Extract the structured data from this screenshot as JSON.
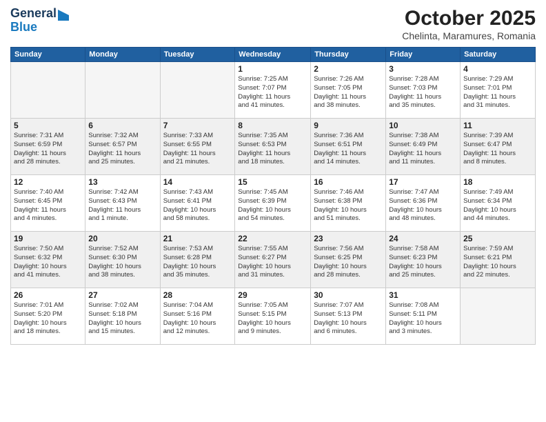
{
  "header": {
    "logo_general": "General",
    "logo_blue": "Blue",
    "month_title": "October 2025",
    "location": "Chelinta, Maramures, Romania"
  },
  "days_of_week": [
    "Sunday",
    "Monday",
    "Tuesday",
    "Wednesday",
    "Thursday",
    "Friday",
    "Saturday"
  ],
  "weeks": [
    [
      {
        "day": "",
        "info": ""
      },
      {
        "day": "",
        "info": ""
      },
      {
        "day": "",
        "info": ""
      },
      {
        "day": "1",
        "info": "Sunrise: 7:25 AM\nSunset: 7:07 PM\nDaylight: 11 hours\nand 41 minutes."
      },
      {
        "day": "2",
        "info": "Sunrise: 7:26 AM\nSunset: 7:05 PM\nDaylight: 11 hours\nand 38 minutes."
      },
      {
        "day": "3",
        "info": "Sunrise: 7:28 AM\nSunset: 7:03 PM\nDaylight: 11 hours\nand 35 minutes."
      },
      {
        "day": "4",
        "info": "Sunrise: 7:29 AM\nSunset: 7:01 PM\nDaylight: 11 hours\nand 31 minutes."
      }
    ],
    [
      {
        "day": "5",
        "info": "Sunrise: 7:31 AM\nSunset: 6:59 PM\nDaylight: 11 hours\nand 28 minutes."
      },
      {
        "day": "6",
        "info": "Sunrise: 7:32 AM\nSunset: 6:57 PM\nDaylight: 11 hours\nand 25 minutes."
      },
      {
        "day": "7",
        "info": "Sunrise: 7:33 AM\nSunset: 6:55 PM\nDaylight: 11 hours\nand 21 minutes."
      },
      {
        "day": "8",
        "info": "Sunrise: 7:35 AM\nSunset: 6:53 PM\nDaylight: 11 hours\nand 18 minutes."
      },
      {
        "day": "9",
        "info": "Sunrise: 7:36 AM\nSunset: 6:51 PM\nDaylight: 11 hours\nand 14 minutes."
      },
      {
        "day": "10",
        "info": "Sunrise: 7:38 AM\nSunset: 6:49 PM\nDaylight: 11 hours\nand 11 minutes."
      },
      {
        "day": "11",
        "info": "Sunrise: 7:39 AM\nSunset: 6:47 PM\nDaylight: 11 hours\nand 8 minutes."
      }
    ],
    [
      {
        "day": "12",
        "info": "Sunrise: 7:40 AM\nSunset: 6:45 PM\nDaylight: 11 hours\nand 4 minutes."
      },
      {
        "day": "13",
        "info": "Sunrise: 7:42 AM\nSunset: 6:43 PM\nDaylight: 11 hours\nand 1 minute."
      },
      {
        "day": "14",
        "info": "Sunrise: 7:43 AM\nSunset: 6:41 PM\nDaylight: 10 hours\nand 58 minutes."
      },
      {
        "day": "15",
        "info": "Sunrise: 7:45 AM\nSunset: 6:39 PM\nDaylight: 10 hours\nand 54 minutes."
      },
      {
        "day": "16",
        "info": "Sunrise: 7:46 AM\nSunset: 6:38 PM\nDaylight: 10 hours\nand 51 minutes."
      },
      {
        "day": "17",
        "info": "Sunrise: 7:47 AM\nSunset: 6:36 PM\nDaylight: 10 hours\nand 48 minutes."
      },
      {
        "day": "18",
        "info": "Sunrise: 7:49 AM\nSunset: 6:34 PM\nDaylight: 10 hours\nand 44 minutes."
      }
    ],
    [
      {
        "day": "19",
        "info": "Sunrise: 7:50 AM\nSunset: 6:32 PM\nDaylight: 10 hours\nand 41 minutes."
      },
      {
        "day": "20",
        "info": "Sunrise: 7:52 AM\nSunset: 6:30 PM\nDaylight: 10 hours\nand 38 minutes."
      },
      {
        "day": "21",
        "info": "Sunrise: 7:53 AM\nSunset: 6:28 PM\nDaylight: 10 hours\nand 35 minutes."
      },
      {
        "day": "22",
        "info": "Sunrise: 7:55 AM\nSunset: 6:27 PM\nDaylight: 10 hours\nand 31 minutes."
      },
      {
        "day": "23",
        "info": "Sunrise: 7:56 AM\nSunset: 6:25 PM\nDaylight: 10 hours\nand 28 minutes."
      },
      {
        "day": "24",
        "info": "Sunrise: 7:58 AM\nSunset: 6:23 PM\nDaylight: 10 hours\nand 25 minutes."
      },
      {
        "day": "25",
        "info": "Sunrise: 7:59 AM\nSunset: 6:21 PM\nDaylight: 10 hours\nand 22 minutes."
      }
    ],
    [
      {
        "day": "26",
        "info": "Sunrise: 7:01 AM\nSunset: 5:20 PM\nDaylight: 10 hours\nand 18 minutes."
      },
      {
        "day": "27",
        "info": "Sunrise: 7:02 AM\nSunset: 5:18 PM\nDaylight: 10 hours\nand 15 minutes."
      },
      {
        "day": "28",
        "info": "Sunrise: 7:04 AM\nSunset: 5:16 PM\nDaylight: 10 hours\nand 12 minutes."
      },
      {
        "day": "29",
        "info": "Sunrise: 7:05 AM\nSunset: 5:15 PM\nDaylight: 10 hours\nand 9 minutes."
      },
      {
        "day": "30",
        "info": "Sunrise: 7:07 AM\nSunset: 5:13 PM\nDaylight: 10 hours\nand 6 minutes."
      },
      {
        "day": "31",
        "info": "Sunrise: 7:08 AM\nSunset: 5:11 PM\nDaylight: 10 hours\nand 3 minutes."
      },
      {
        "day": "",
        "info": ""
      }
    ]
  ]
}
